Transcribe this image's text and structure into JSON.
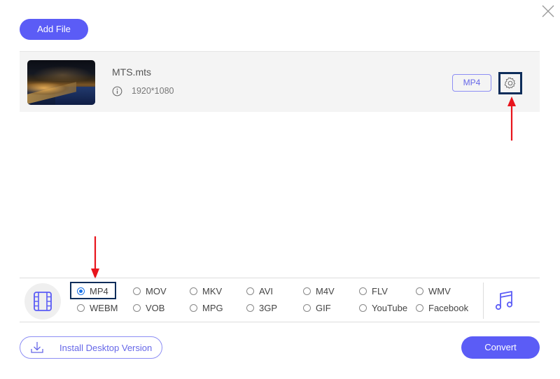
{
  "window": {
    "close_label": "close"
  },
  "toolbar": {
    "add_file_label": "Add File"
  },
  "file": {
    "name": "MTS.mts",
    "resolution": "1920*1080",
    "output_format": "MP4",
    "thumbnail": "night-harbor-city-thumbnail"
  },
  "formats": {
    "video_category_icon": "film-strip-icon",
    "audio_category_icon": "music-note-icon",
    "selected": "MP4",
    "options": [
      {
        "label": "MP4",
        "checked": true
      },
      {
        "label": "MOV",
        "checked": false
      },
      {
        "label": "MKV",
        "checked": false
      },
      {
        "label": "AVI",
        "checked": false
      },
      {
        "label": "M4V",
        "checked": false
      },
      {
        "label": "FLV",
        "checked": false
      },
      {
        "label": "WMV",
        "checked": false
      },
      {
        "label": "WEBM",
        "checked": false
      },
      {
        "label": "VOB",
        "checked": false
      },
      {
        "label": "MPG",
        "checked": false
      },
      {
        "label": "3GP",
        "checked": false
      },
      {
        "label": "GIF",
        "checked": false
      },
      {
        "label": "YouTube",
        "checked": false
      },
      {
        "label": "Facebook",
        "checked": false
      }
    ]
  },
  "footer": {
    "install_label": "Install Desktop Version",
    "convert_label": "Convert"
  },
  "colors": {
    "accent": "#5b5cf6",
    "annotation_box": "#0d2d5a",
    "annotation_arrow": "#e8141c",
    "radio_selected": "#1a73e8"
  }
}
